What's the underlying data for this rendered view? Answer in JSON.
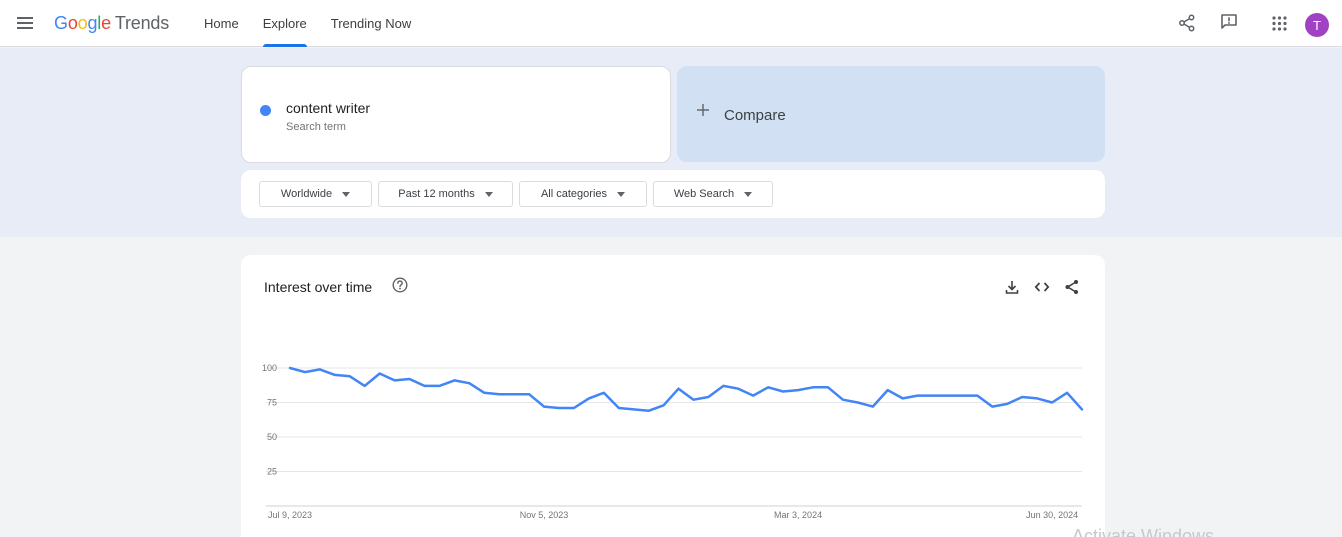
{
  "header": {
    "logo_google": "Google",
    "logo_product": "Trends",
    "nav": [
      {
        "label": "Home"
      },
      {
        "label": "Explore"
      },
      {
        "label": "Trending Now"
      }
    ],
    "icons": [
      "menu-icon",
      "share-icon",
      "feedback-icon",
      "apps-icon"
    ],
    "avatar_letter": "T",
    "accent": "#1a73e8"
  },
  "search": {
    "term": "content writer",
    "term_type": "Search term",
    "term_color": "#4285f4",
    "compare_label": "Compare"
  },
  "filters": {
    "region": "Worldwide",
    "time": "Past 12 months",
    "category": "All categories",
    "property": "Web Search"
  },
  "chart_card": {
    "title": "Interest over time",
    "icons": [
      "help-icon",
      "download-icon",
      "embed-icon",
      "share-icon"
    ]
  },
  "chart_data": {
    "type": "line",
    "title": "Interest over time",
    "xlabel": "",
    "ylabel": "",
    "ylim": [
      0,
      100
    ],
    "yticks": [
      25,
      50,
      75,
      100
    ],
    "ytick_labels": [
      "25",
      "50",
      "75",
      "100"
    ],
    "xtick_labels": [
      "Jul 9, 2023",
      "Nov 5, 2023",
      "Mar 3, 2024",
      "Jun 30, 2024"
    ],
    "xtick_indices": [
      0,
      17,
      34,
      51
    ],
    "grid": true,
    "series": [
      {
        "color": "#4285f4",
        "values": [
          100,
          97,
          99,
          95,
          94,
          87,
          96,
          91,
          92,
          87,
          87,
          91,
          89,
          82,
          81,
          81,
          81,
          72,
          71,
          71,
          78,
          82,
          71,
          70,
          69,
          73,
          85,
          77,
          79,
          87,
          85,
          80,
          86,
          83,
          84,
          86,
          86,
          77,
          75,
          72,
          84,
          78,
          80,
          80,
          80,
          80,
          80,
          72,
          74,
          79,
          78,
          75,
          82,
          70
        ]
      }
    ]
  },
  "watermark": "Activate Windows"
}
